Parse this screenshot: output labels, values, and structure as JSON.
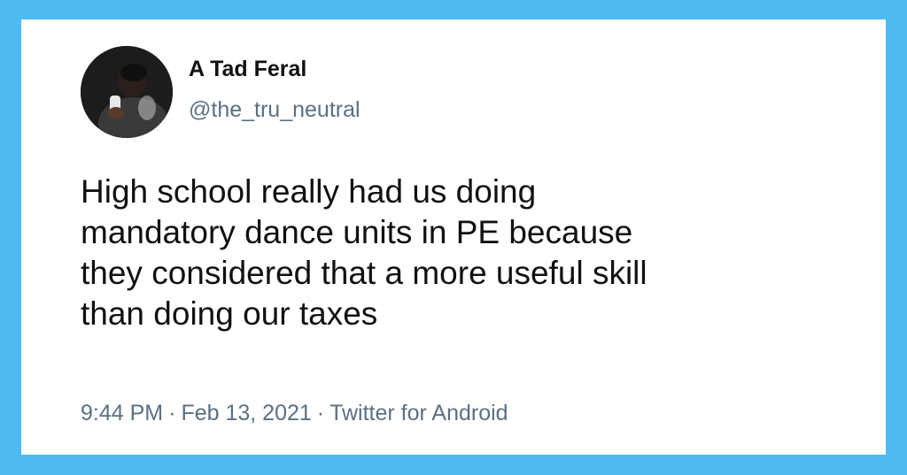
{
  "tweet": {
    "author": {
      "display_name": "A Tad Feral",
      "handle": "@the_tru_neutral",
      "avatar_icon": "profile-photo"
    },
    "text_lines": [
      "High school really had us doing",
      "mandatory dance units in PE because",
      "they considered that a more useful skill",
      "than doing our taxes"
    ],
    "time": "9:44 PM",
    "date": "Feb 13, 2021",
    "source": "Twitter for Android",
    "separator": "·"
  },
  "colors": {
    "background": "#4ebaf2",
    "card": "#ffffff",
    "text_primary": "#111111",
    "text_secondary": "#5b7083"
  }
}
